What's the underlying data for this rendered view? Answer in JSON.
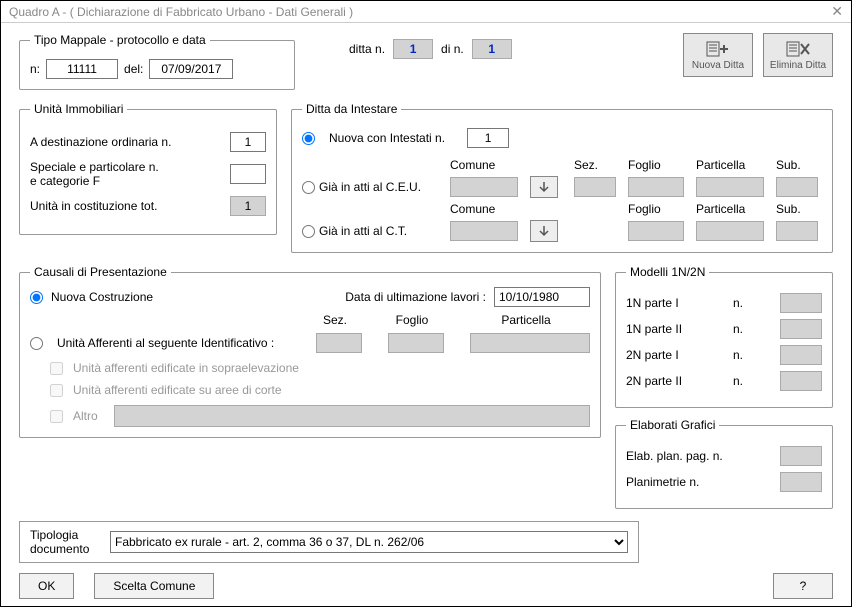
{
  "window": {
    "title": "Quadro A - ( Dichiarazione di Fabbricato Urbano - Dati Generali )"
  },
  "tipo_mappale": {
    "legend": "Tipo Mappale - protocollo e data",
    "n_label": "n:",
    "n_value": "11111",
    "del_label": "del:",
    "del_value": "07/09/2017"
  },
  "ditta_top": {
    "ditta_n_label": "ditta n.",
    "ditta_n_value": "1",
    "di_n_label": "di  n.",
    "di_n_value": "1"
  },
  "toolbar": {
    "nuova_ditta": "Nuova Ditta",
    "elimina_ditta": "Elimina Ditta"
  },
  "unita_imm": {
    "legend": "Unità Immobiliari",
    "dest_ord_label": "A destinazione ordinaria   n.",
    "dest_ord_value": "1",
    "speciale_label": "Speciale e particolare     n.\ne categorie F",
    "speciale_value": "",
    "costituzione_label": "Unità in costituzione      tot.",
    "costituzione_value": "1"
  },
  "ditta_intestare": {
    "legend": "Ditta da Intestare",
    "nuova_label": "Nuova con Intestati   n.",
    "nuova_value": "1",
    "ceu_label": "Già in atti al C.E.U.",
    "ct_label": "Già in atti al C.T.",
    "col_comune": "Comune",
    "col_sez": "Sez.",
    "col_foglio": "Foglio",
    "col_particella": "Particella",
    "col_sub": "Sub."
  },
  "causali": {
    "legend": "Causali di Presentazione",
    "nuova_costruzione": "Nuova Costruzione",
    "data_ult_label": "Data di ultimazione lavori :",
    "data_ult_value": "10/10/1980",
    "col_sez": "Sez.",
    "col_foglio": "Foglio",
    "col_particella": "Particella",
    "unita_afferenti": "Unità Afferenti al seguente Identificativo  :",
    "chk_sopra": "Unità afferenti edificate in sopraelevazione",
    "chk_corte": "Unità afferenti edificate su aree di corte",
    "chk_altro": "Altro"
  },
  "modelli": {
    "legend": "Modelli 1N/2N",
    "n1p1": "1N parte I",
    "n1p2": "1N parte II",
    "n2p1": "2N parte I",
    "n2p2": "2N parte II",
    "n_label": "n."
  },
  "elaborati": {
    "legend": "Elaborati Grafici",
    "elab_label": "Elab. plan. pag. n.",
    "plan_label": "Planimetrie       n."
  },
  "tipologia": {
    "label": "Tipologia\ndocumento",
    "selected": "Fabbricato ex rurale - art. 2, comma 36 o 37, DL n. 262/06"
  },
  "buttons": {
    "ok": "OK",
    "scelta_comune": "Scelta Comune",
    "help": "?"
  }
}
